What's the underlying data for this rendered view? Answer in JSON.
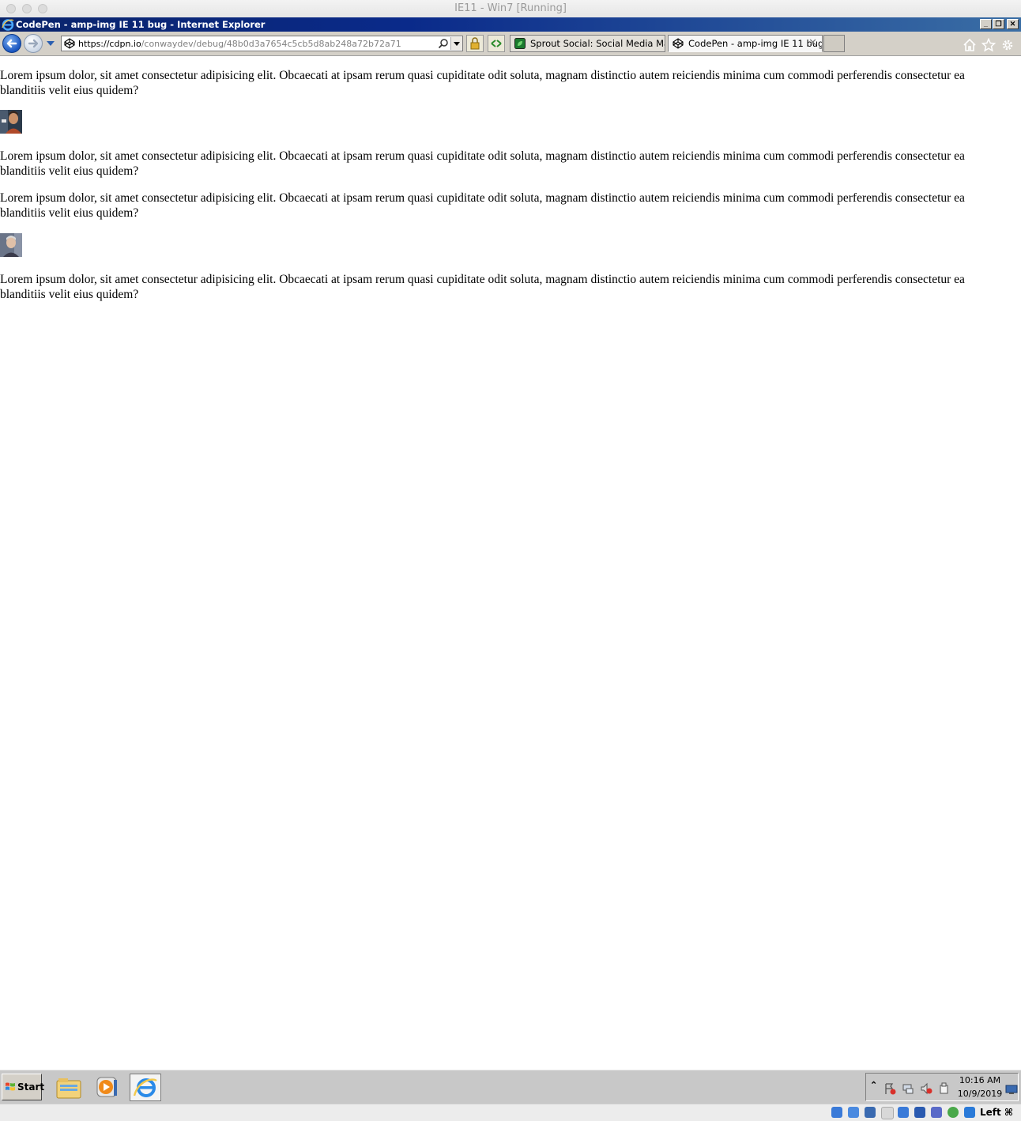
{
  "host_window": {
    "title": "IE11 - Win7 [Running]"
  },
  "browser": {
    "title": "CodePen - amp-img IE 11 bug - Internet Explorer",
    "address": {
      "scheme_host": "https://cdpn.io",
      "path": "/conwaydev/debug/48b0d3a7654c5cb5d8ab248a72b72a71"
    },
    "tabs": [
      {
        "label": "Sprout Social: Social Media Man...",
        "active": false,
        "icon": "sprout-favicon"
      },
      {
        "label": "CodePen - amp-img IE 11 bug",
        "active": true,
        "icon": "codepen-favicon"
      }
    ],
    "window_buttons": {
      "minimize": "_",
      "restore": "❐",
      "close": "✕"
    },
    "tab_close_glyph": "✕"
  },
  "page": {
    "paragraphs": [
      "Lorem ipsum dolor, sit amet consectetur adipisicing elit. Obcaecati at ipsam rerum quasi cupiditate odit soluta, magnam distinctio autem reiciendis minima cum commodi perferendis consectetur ea blanditiis velit eius quidem?",
      "Lorem ipsum dolor, sit amet consectetur adipisicing elit. Obcaecati at ipsam rerum quasi cupiditate odit soluta, magnam distinctio autem reiciendis minima cum commodi perferendis consectetur ea blanditiis velit eius quidem?",
      "Lorem ipsum dolor, sit amet consectetur adipisicing elit. Obcaecati at ipsam rerum quasi cupiditate odit soluta, magnam distinctio autem reiciendis minima cum commodi perferendis consectetur ea blanditiis velit eius quidem?",
      "Lorem ipsum dolor, sit amet consectetur adipisicing elit. Obcaecati at ipsam rerum quasi cupiditate odit soluta, magnam distinctio autem reiciendis minima cum commodi perferendis consectetur ea blanditiis velit eius quidem?"
    ]
  },
  "taskbar": {
    "start_label": "Start",
    "apps": [
      "file-explorer-icon",
      "media-player-icon",
      "internet-explorer-icon"
    ],
    "clock": {
      "time": "10:16 AM",
      "date": "10/9/2019"
    },
    "tray_chevron": "⌃"
  },
  "vm_status": {
    "host_key": "Left ⌘"
  },
  "colors": {
    "ie_title_start": "#0a246a",
    "ie_title_end": "#3a6ea5",
    "chrome_gray": "#d4d0c8",
    "taskbar_gray": "#c8c8c8"
  }
}
